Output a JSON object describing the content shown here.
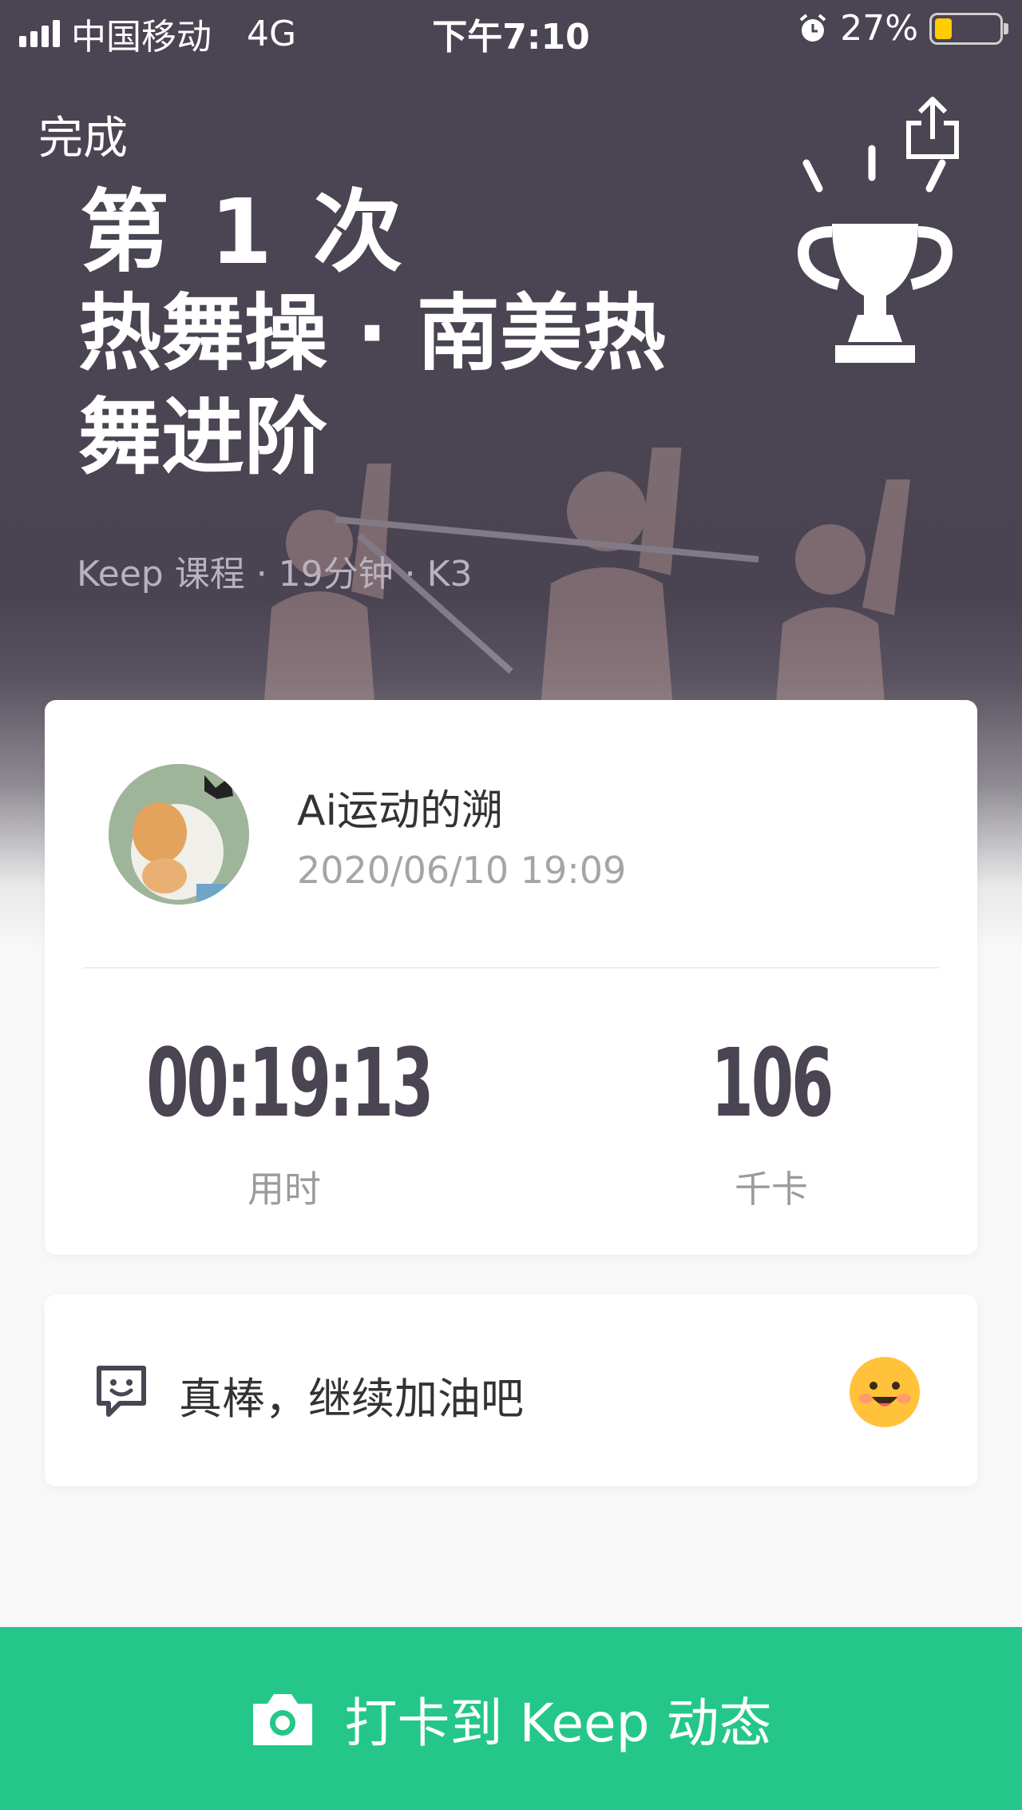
{
  "status_bar": {
    "carrier": "中国移动",
    "network": "4G",
    "time": "下午7:10",
    "battery_percent": "27%",
    "battery_level": 0.27
  },
  "header": {
    "done_label": "完成",
    "share_icon": "share-icon",
    "trophy_icon": "trophy-icon"
  },
  "workout": {
    "count_title": "第 1 次",
    "course_title": "热舞操 · 南美热舞进阶",
    "meta": "Keep 课程 · 19分钟 · K3"
  },
  "user": {
    "name": "Ai运动的溯",
    "datetime": "2020/06/10 19:09"
  },
  "stats": {
    "duration_value": "00:19:13",
    "duration_label": "用时",
    "calories_value": "106",
    "calories_label": "千卡"
  },
  "comment": {
    "icon": "comment-icon",
    "text": "真棒，继续加油吧",
    "emoji": "smiley-emoji-icon"
  },
  "action": {
    "checkin_label": "打卡到 Keep 动态",
    "icon": "camera-icon",
    "color": "#24c789"
  }
}
